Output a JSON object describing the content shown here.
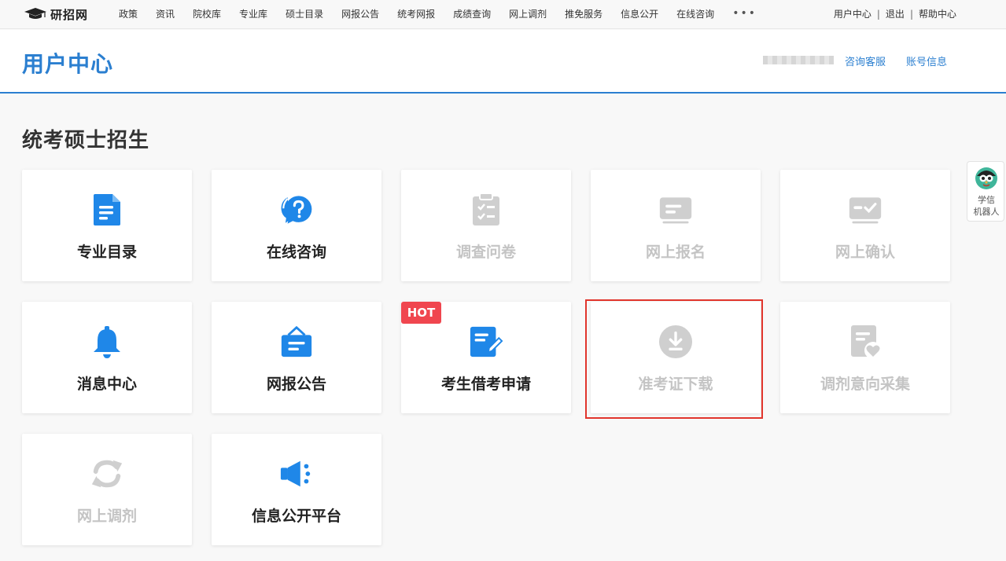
{
  "logo": {
    "text": "研招网"
  },
  "nav": {
    "items": [
      "政策",
      "资讯",
      "院校库",
      "专业库",
      "硕士目录",
      "网报公告",
      "统考网报",
      "成绩查询",
      "网上调剂",
      "推免服务",
      "信息公开",
      "在线咨询"
    ],
    "more": "•••"
  },
  "top_right": {
    "user_center": "用户中心",
    "logout": "退出",
    "help": "帮助中心",
    "separator": "|"
  },
  "header": {
    "title": "用户中心",
    "consult": "咨询客服",
    "account": "账号信息"
  },
  "section": {
    "title": "统考硕士招生"
  },
  "tiles": [
    {
      "label": "专业目录",
      "icon": "document-list-icon",
      "enabled": true
    },
    {
      "label": "在线咨询",
      "icon": "question-chat-icon",
      "enabled": true
    },
    {
      "label": "调查问卷",
      "icon": "clipboard-check-icon",
      "enabled": false
    },
    {
      "label": "网上报名",
      "icon": "id-card-icon",
      "enabled": false
    },
    {
      "label": "网上确认",
      "icon": "card-check-icon",
      "enabled": false
    },
    {
      "label": "消息中心",
      "icon": "bell-icon",
      "enabled": true
    },
    {
      "label": "网报公告",
      "icon": "notice-board-icon",
      "enabled": true
    },
    {
      "label": "考生借考申请",
      "icon": "document-edit-icon",
      "enabled": true,
      "badge": "HOT"
    },
    {
      "label": "准考证下载",
      "icon": "download-circle-icon",
      "enabled": false,
      "highlighted": true
    },
    {
      "label": "调剂意向采集",
      "icon": "document-heart-icon",
      "enabled": false
    },
    {
      "label": "网上调剂",
      "icon": "refresh-arrows-icon",
      "enabled": false
    },
    {
      "label": "信息公开平台",
      "icon": "megaphone-icon",
      "enabled": true
    }
  ],
  "robot": {
    "line1": "学信",
    "line2": "机器人"
  },
  "colors": {
    "accent": "#2b7fd0",
    "icon_blue": "#1f87e8",
    "disabled": "#c4c4c4",
    "hot": "#f0464f",
    "highlight_border": "#e1352c"
  }
}
